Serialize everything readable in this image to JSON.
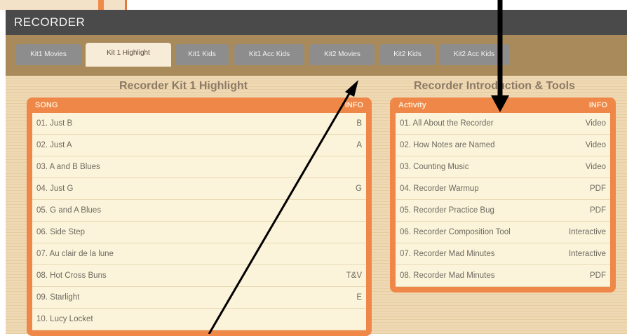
{
  "window": {
    "title": "RECORDER"
  },
  "tabs": [
    {
      "label": "Kit1 Movies",
      "active": false
    },
    {
      "label": "Kit 1 Highlight",
      "active": true
    },
    {
      "label": "Kit1 Kids",
      "active": false
    },
    {
      "label": "Kit1 Acc Kids",
      "active": false
    },
    {
      "label": "Kit2 Movies",
      "active": false
    },
    {
      "label": "Kit2 Kids",
      "active": false
    },
    {
      "label": "Kit2 Acc Kids",
      "active": false
    }
  ],
  "songs_panel": {
    "title": "Recorder Kit 1 Highlight",
    "col_name": "SONG",
    "col_info": "INFO",
    "rows": [
      {
        "name": "01. Just B",
        "info": "B"
      },
      {
        "name": "02. Just A",
        "info": "A"
      },
      {
        "name": "03. A and B Blues",
        "info": ""
      },
      {
        "name": "04. Just G",
        "info": "G"
      },
      {
        "name": "05. G and A Blues",
        "info": ""
      },
      {
        "name": "06. Side Step",
        "info": ""
      },
      {
        "name": "07. Au clair de la lune",
        "info": ""
      },
      {
        "name": "08. Hot Cross Buns",
        "info": "T&V"
      },
      {
        "name": "09. Starlight",
        "info": "E"
      },
      {
        "name": "10. Lucy Locket",
        "info": ""
      }
    ]
  },
  "tools_panel": {
    "title": "Recorder Introduction & Tools",
    "col_name": "Activity",
    "col_info": "INFO",
    "rows": [
      {
        "name": "01. All About the Recorder",
        "info": "Video"
      },
      {
        "name": "02. How Notes are Named",
        "info": "Video"
      },
      {
        "name": "03. Counting Music",
        "info": "Video"
      },
      {
        "name": "04. Recorder Warmup",
        "info": "PDF"
      },
      {
        "name": "05. Recorder Practice Bug",
        "info": "PDF"
      },
      {
        "name": "06. Recorder Composition Tool",
        "info": "Interactive"
      },
      {
        "name": "07. Recorder Mad Minutes",
        "info": "Interactive"
      },
      {
        "name": "08. Recorder Mad Minutes",
        "info": "PDF"
      }
    ]
  },
  "colors": {
    "title_bar": "#4a4a4a",
    "tab_strip": "#a98a5a",
    "tab_inactive": "#8d8d8d",
    "tab_active": "#f6ecd8",
    "panel_accent": "#ef8748",
    "row_background": "#fbf4da",
    "content_background": "#efd9b5"
  }
}
